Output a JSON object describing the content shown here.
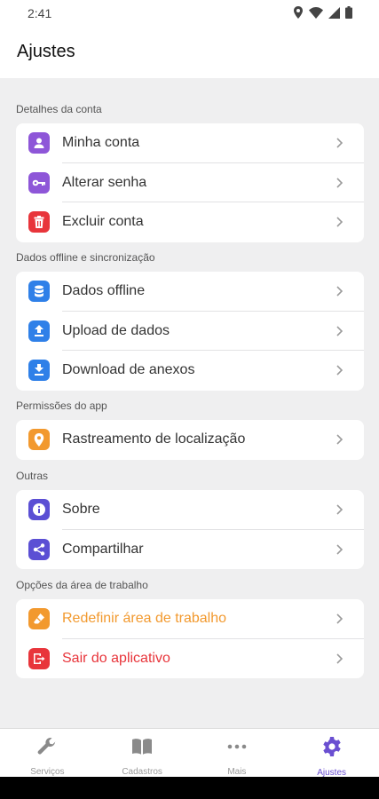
{
  "status": {
    "time": "2:41"
  },
  "header": {
    "title": "Ajustes"
  },
  "sections": [
    {
      "label": "Detalhes da conta",
      "items": [
        {
          "label": "Minha conta",
          "icon": "person-icon",
          "color": "#8e56d8"
        },
        {
          "label": "Alterar senha",
          "icon": "key-icon",
          "color": "#8e56d8"
        },
        {
          "label": "Excluir conta",
          "icon": "trash-icon",
          "color": "#e8353b"
        }
      ]
    },
    {
      "label": "Dados offline e sincronização",
      "items": [
        {
          "label": "Dados offline",
          "icon": "database-icon",
          "color": "#2f80e8"
        },
        {
          "label": "Upload de dados",
          "icon": "upload-icon",
          "color": "#2f80e8"
        },
        {
          "label": "Download de anexos",
          "icon": "download-icon",
          "color": "#2f80e8"
        }
      ]
    },
    {
      "label": "Permissões do app",
      "items": [
        {
          "label": "Rastreamento de localização",
          "icon": "location-icon",
          "color": "#f2992e"
        }
      ]
    },
    {
      "label": "Outras",
      "items": [
        {
          "label": "Sobre",
          "icon": "info-icon",
          "color": "#5b4fd4"
        },
        {
          "label": "Compartilhar",
          "icon": "share-icon",
          "color": "#5b4fd4"
        }
      ]
    },
    {
      "label": "Opções da área de trabalho",
      "items": [
        {
          "label": "Redefinir área de trabalho",
          "icon": "eraser-icon",
          "color": "#f2992e",
          "text_color": "#f2992e"
        },
        {
          "label": "Sair do aplicativo",
          "icon": "logout-icon",
          "color": "#e8353b",
          "text_color": "#e8353b"
        }
      ]
    }
  ],
  "nav": [
    {
      "label": "Serviços",
      "icon": "wrench-icon",
      "active": false
    },
    {
      "label": "Cadastros",
      "icon": "book-icon",
      "active": false
    },
    {
      "label": "Mais",
      "icon": "more-icon",
      "active": false
    },
    {
      "label": "Ajustes",
      "icon": "gear-icon",
      "active": true
    }
  ],
  "colors": {
    "accent": "#6a4fd1",
    "inactive": "#8a8a8a"
  }
}
